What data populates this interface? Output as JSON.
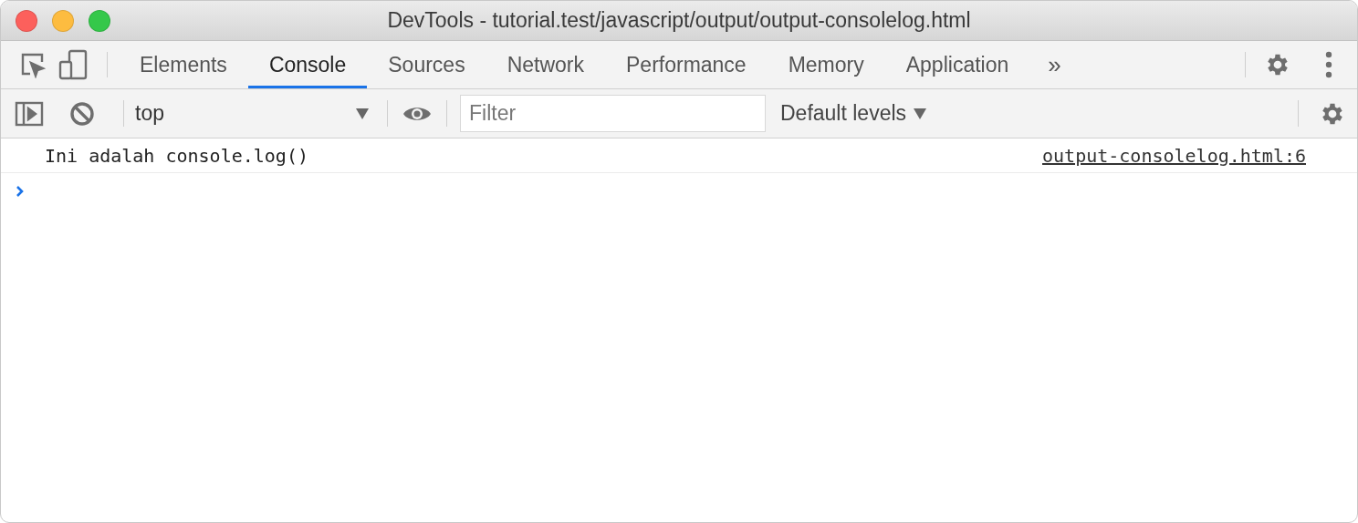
{
  "window": {
    "title": "DevTools - tutorial.test/javascript/output/output-consolelog.html"
  },
  "tabs": [
    {
      "label": "Elements",
      "selected": false
    },
    {
      "label": "Console",
      "selected": true
    },
    {
      "label": "Sources",
      "selected": false
    },
    {
      "label": "Network",
      "selected": false
    },
    {
      "label": "Performance",
      "selected": false
    },
    {
      "label": "Memory",
      "selected": false
    },
    {
      "label": "Application",
      "selected": false
    }
  ],
  "more_tabs": "»",
  "toolbar": {
    "context": "top",
    "filter": {
      "placeholder": "Filter"
    },
    "levels": "Default levels"
  },
  "messages": [
    {
      "text": "Ini adalah console.log()",
      "source": "output-consolelog.html:6"
    }
  ]
}
